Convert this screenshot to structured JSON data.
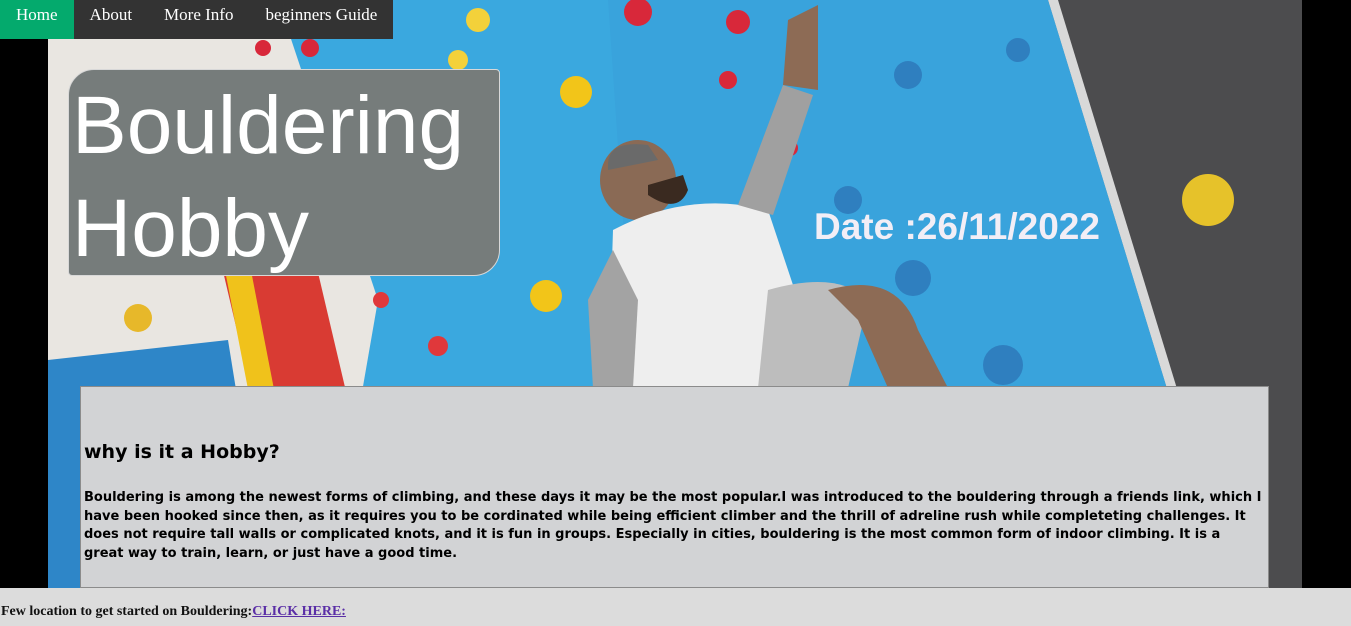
{
  "nav": {
    "items": [
      {
        "label": "Home"
      },
      {
        "label": "About"
      },
      {
        "label": "More Info"
      },
      {
        "label": "beginners Guide"
      }
    ]
  },
  "hero": {
    "title_line1": "Bouldering",
    "title_line2": "Hobby",
    "date": "Date :26/11/2022"
  },
  "content": {
    "heading": "why is it a Hobby?",
    "paragraph": "Bouldering is among the newest forms of climbing, and these days it may be the most popular.I was introduced to the bouldering through a friends link, which I have been hooked since then, as it requires you to be cordinated while being efficient climber and the thrill of adreline rush while completeting challenges. It does not require tall walls or complicated knots, and it is fun in groups. Especially in cities, bouldering is the most common form of indoor climbing. It is a great way to train, learn, or just have a good time."
  },
  "footer": {
    "text": "Few location to get started on Bouldering:",
    "link": "CLICK HERE:"
  },
  "colors": {
    "nav_bg": "#333333",
    "nav_active": "#04AA6D",
    "wall_blue": "#39a9e0",
    "title_box": "#767c7b",
    "content_bg": "#d2d3d5",
    "link": "#5a2ea6"
  }
}
